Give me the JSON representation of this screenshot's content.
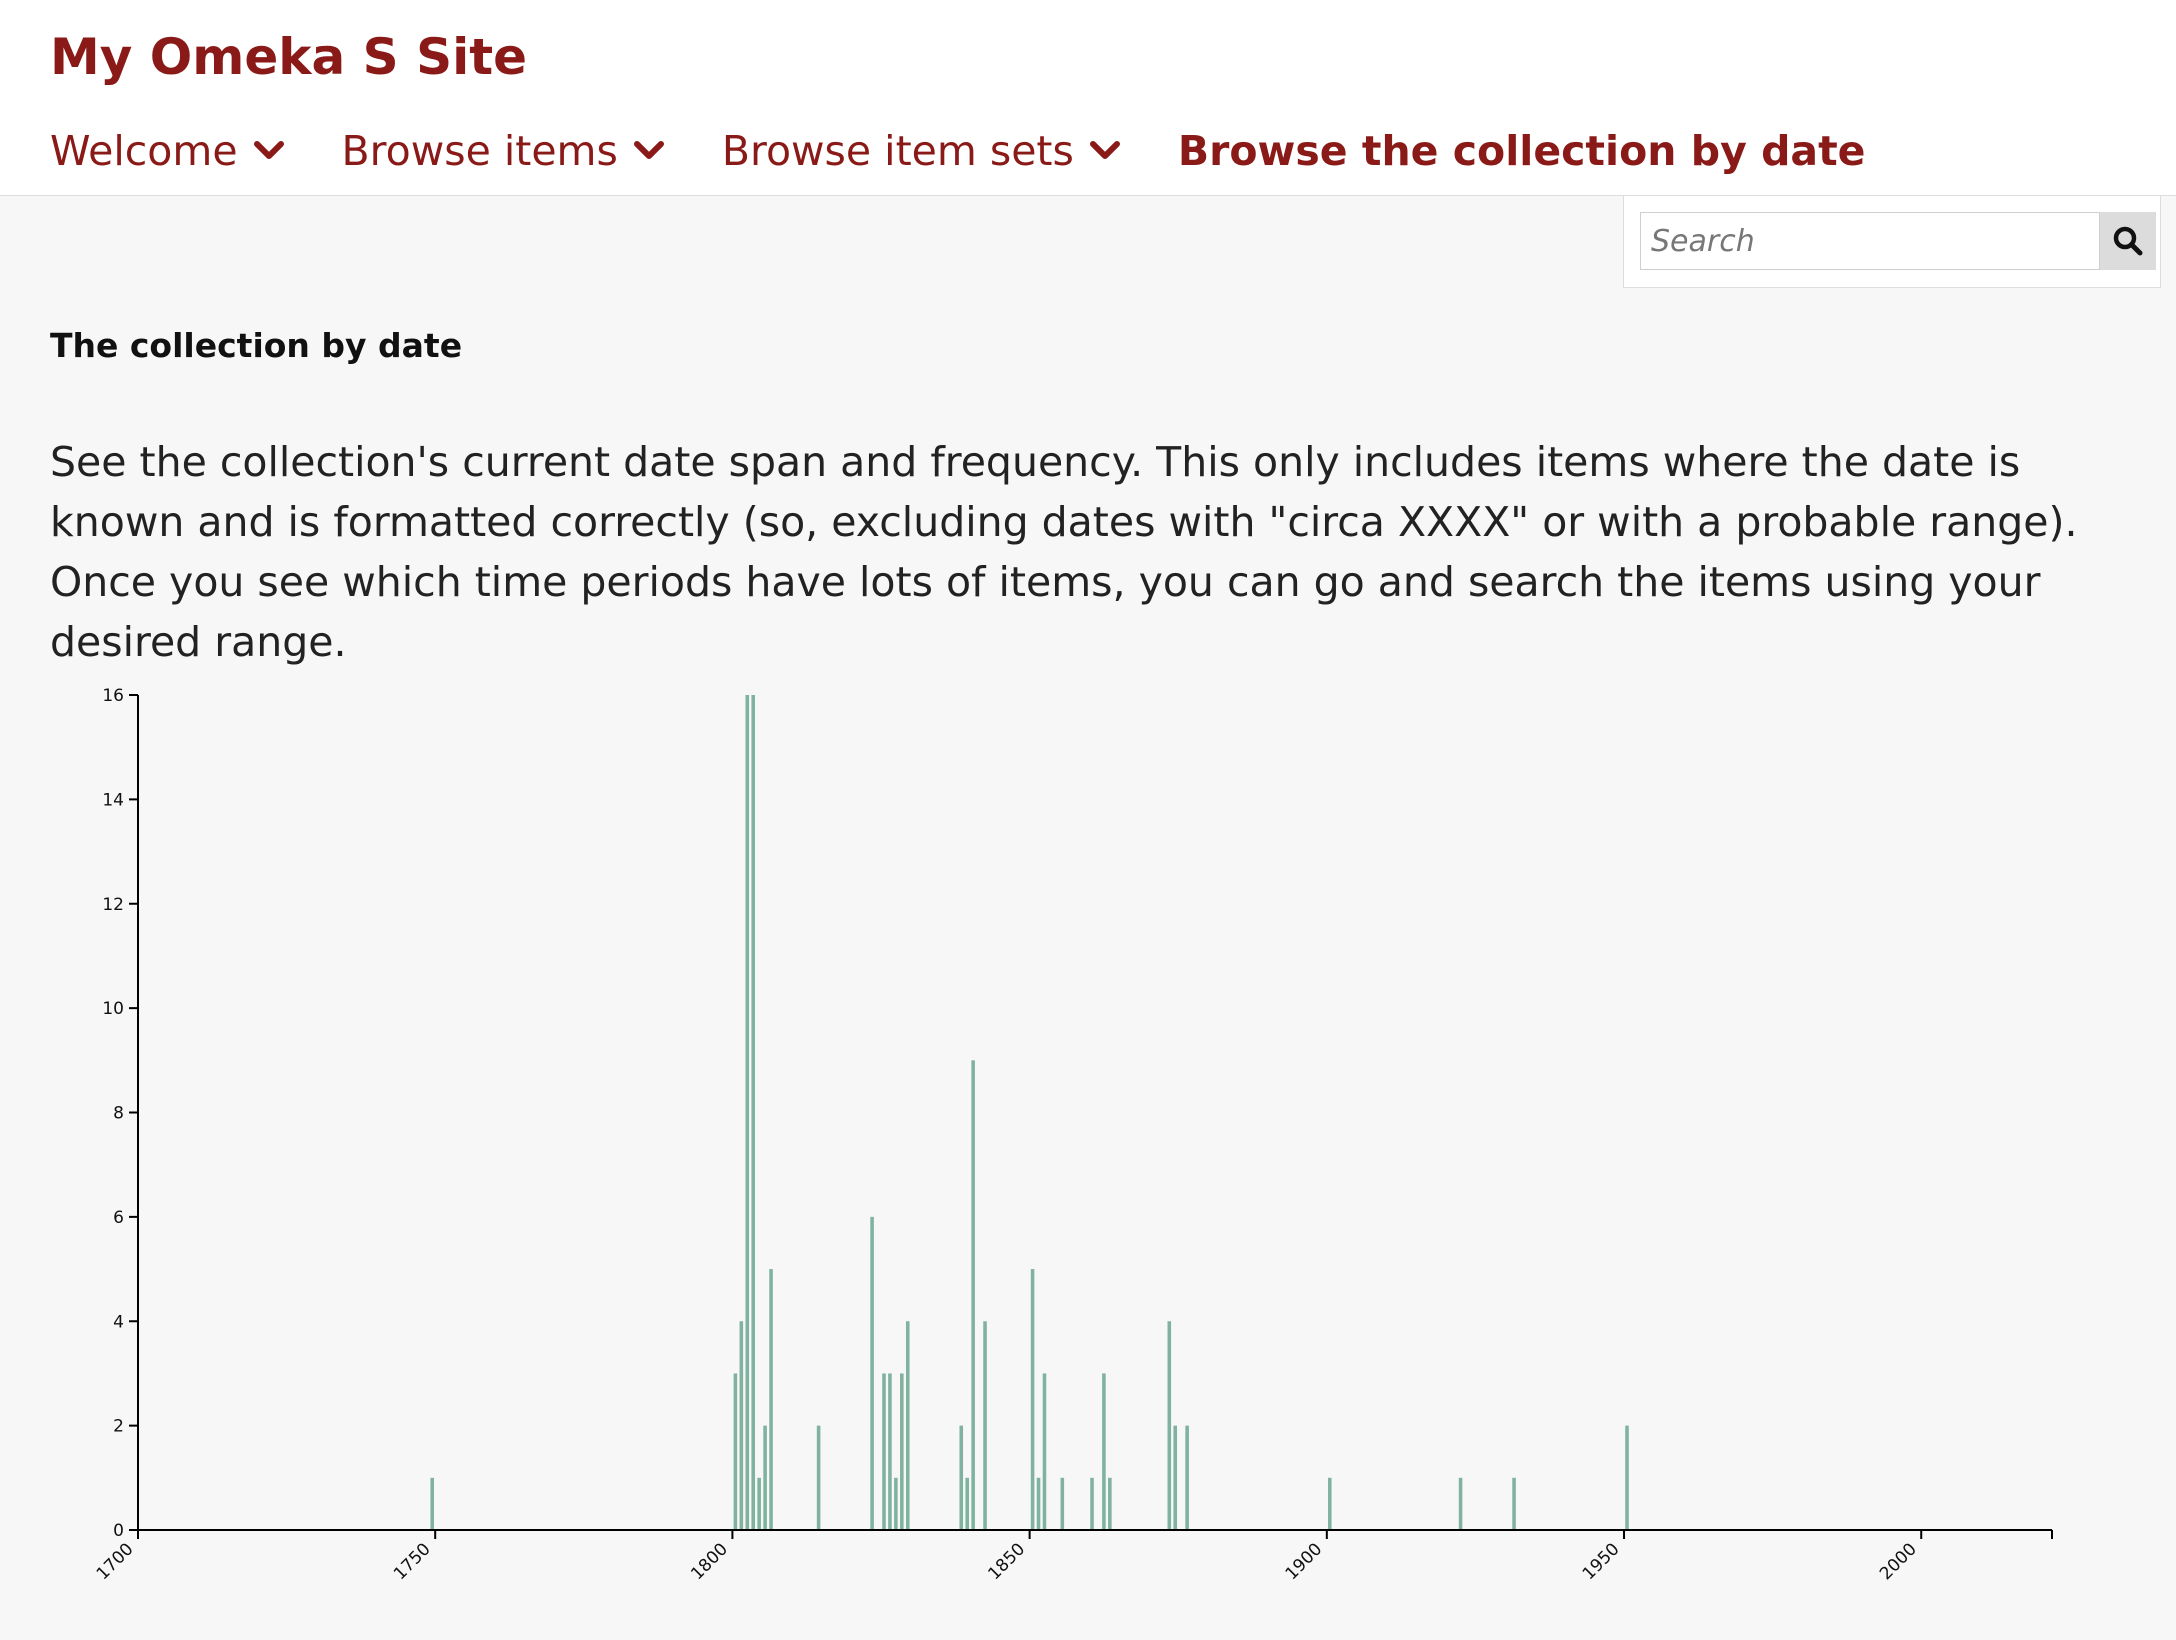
{
  "site": {
    "title": "My Omeka S Site"
  },
  "nav": {
    "items": [
      {
        "label": "Welcome",
        "has_dropdown": true
      },
      {
        "label": "Browse items",
        "has_dropdown": true
      },
      {
        "label": "Browse item sets",
        "has_dropdown": true
      },
      {
        "label": "Browse the collection by date",
        "has_dropdown": false,
        "active": true
      }
    ]
  },
  "search": {
    "placeholder": "Search",
    "value": "",
    "button_icon": "search-icon"
  },
  "page": {
    "heading": "The collection by date",
    "intro": "See the collection's current date span and frequency. This only includes items where the date is known and is formatted correctly (so, excluding dates with \"circa XXXX\" or with a probable range). Once you see which time periods have lots of items, you can go and search the items using your desired range."
  },
  "colors": {
    "brand": "#8a1a17",
    "bar": "#7fb3a0",
    "background": "#f7f7f7"
  },
  "chart_data": {
    "type": "bar",
    "title": "",
    "xlabel": "",
    "ylabel": "",
    "xlim": [
      1700,
      2022
    ],
    "ylim": [
      0,
      16
    ],
    "x_ticks": [
      1700,
      1750,
      1800,
      1850,
      1900,
      1950,
      2000
    ],
    "y_ticks": [
      0,
      2,
      4,
      6,
      8,
      10,
      12,
      14,
      16
    ],
    "grid": false,
    "x": [
      1749,
      1800,
      1801,
      1802,
      1803,
      1804,
      1805,
      1806,
      1814,
      1823,
      1825,
      1826,
      1827,
      1828,
      1829,
      1838,
      1839,
      1840,
      1842,
      1850,
      1851,
      1852,
      1855,
      1860,
      1862,
      1863,
      1873,
      1874,
      1876,
      1900,
      1922,
      1931,
      1950
    ],
    "values": [
      1,
      3,
      4,
      16,
      16,
      1,
      2,
      5,
      2,
      6,
      3,
      3,
      1,
      3,
      4,
      2,
      1,
      9,
      4,
      5,
      1,
      3,
      1,
      1,
      3,
      1,
      4,
      2,
      2,
      1,
      1,
      1,
      2
    ]
  }
}
